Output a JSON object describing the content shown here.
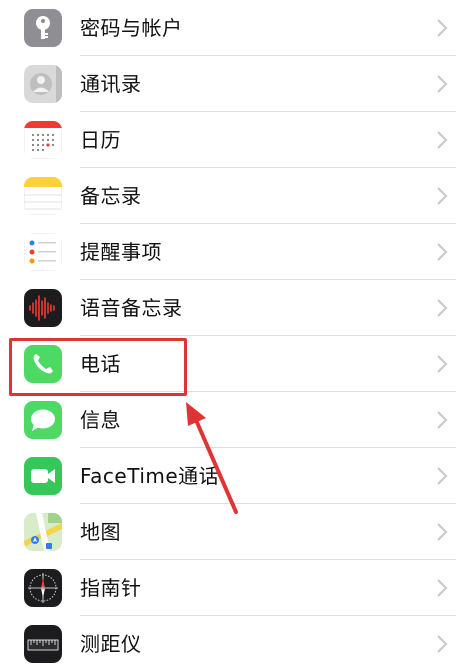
{
  "settings_list": {
    "items": [
      {
        "label": "密码与帐户",
        "icon": "key-icon"
      },
      {
        "label": "通讯录",
        "icon": "contacts-icon"
      },
      {
        "label": "日历",
        "icon": "calendar-icon"
      },
      {
        "label": "备忘录",
        "icon": "notes-icon"
      },
      {
        "label": "提醒事项",
        "icon": "reminders-icon"
      },
      {
        "label": "语音备忘录",
        "icon": "voice-memos-icon"
      },
      {
        "label": "电话",
        "icon": "phone-icon"
      },
      {
        "label": "信息",
        "icon": "messages-icon"
      },
      {
        "label": "FaceTime通话",
        "icon": "facetime-icon"
      },
      {
        "label": "地图",
        "icon": "maps-icon"
      },
      {
        "label": "指南针",
        "icon": "compass-icon"
      },
      {
        "label": "测距仪",
        "icon": "measure-icon"
      }
    ]
  },
  "colors": {
    "highlight": "#e03434",
    "chevron": "#c7c7cc",
    "separator": "#dddddd",
    "phone_green": "#4cd964",
    "facetime_green": "#34c759"
  }
}
